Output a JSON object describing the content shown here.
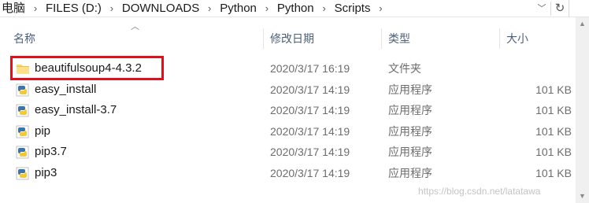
{
  "address_bar": {
    "crumbs": [
      "电脑",
      "FILES (D:)",
      "DOWNLOADS",
      "Python",
      "Python",
      "Scripts"
    ],
    "separator_icon": "chevron-right-icon",
    "dropdown_icon": "chevron-down-icon",
    "refresh_icon": "refresh-icon"
  },
  "columns": {
    "name": "名称",
    "date": "修改日期",
    "type": "类型",
    "size": "大小",
    "sort_indicator": "sort-ascending-icon"
  },
  "files": [
    {
      "name": "beautifulsoup4-4.3.2",
      "date": "2020/3/17 16:19",
      "type": "文件夹",
      "size": "",
      "icon": "folder-icon",
      "highlighted": true
    },
    {
      "name": "easy_install",
      "date": "2020/3/17 14:19",
      "type": "应用程序",
      "size": "101 KB",
      "icon": "python-exe-icon"
    },
    {
      "name": "easy_install-3.7",
      "date": "2020/3/17 14:19",
      "type": "应用程序",
      "size": "101 KB",
      "icon": "python-exe-icon"
    },
    {
      "name": "pip",
      "date": "2020/3/17 14:19",
      "type": "应用程序",
      "size": "101 KB",
      "icon": "python-exe-icon"
    },
    {
      "name": "pip3.7",
      "date": "2020/3/17 14:19",
      "type": "应用程序",
      "size": "101 KB",
      "icon": "python-exe-icon"
    },
    {
      "name": "pip3",
      "date": "2020/3/17 14:19",
      "type": "应用程序",
      "size": "101 KB",
      "icon": "python-exe-icon"
    }
  ],
  "highlight_color": "#e0101a",
  "watermark": "https://blog.csdn.net/latatawa"
}
